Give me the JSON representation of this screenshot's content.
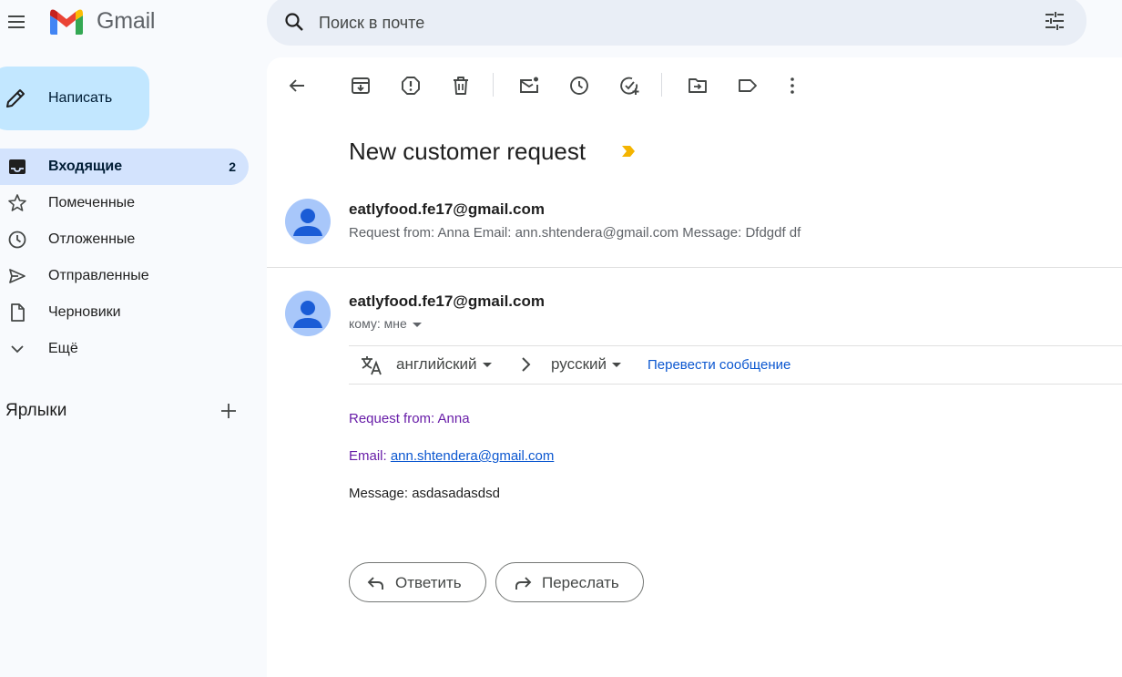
{
  "app": {
    "name": "Gmail",
    "brand_colors": [
      "#ea4335",
      "#4285f4",
      "#34a853",
      "#fbbc04",
      "#c5221f"
    ]
  },
  "search": {
    "placeholder": "Поиск в почте",
    "value": ""
  },
  "compose": {
    "label": "Написать",
    "icon": "pencil-icon"
  },
  "sidebar": {
    "items": [
      {
        "label": "Входящие",
        "icon": "inbox-icon",
        "count": "2",
        "active": true
      },
      {
        "label": "Помеченные",
        "icon": "star-icon",
        "count": "",
        "active": false
      },
      {
        "label": "Отложенные",
        "icon": "clock-icon",
        "count": "",
        "active": false
      },
      {
        "label": "Отправленные",
        "icon": "send-icon",
        "count": "",
        "active": false
      },
      {
        "label": "Черновики",
        "icon": "draft-icon",
        "count": "",
        "active": false
      },
      {
        "label": "Ещё",
        "icon": "chevron-down-icon",
        "count": "",
        "active": false
      }
    ],
    "labels_title": "Ярлыки"
  },
  "toolbar": {
    "actions": [
      "back",
      "archive",
      "report-spam",
      "delete",
      "mark-unread",
      "snooze",
      "add-to-tasks",
      "move-to",
      "labels",
      "more"
    ]
  },
  "email": {
    "subject": "New customer request",
    "importance_color": "#f4b400",
    "collapsed": {
      "sender": "eatlyfood.fe17@gmail.com",
      "snippet": "Request from: Anna Email: ann.shtendera@gmail.com Message: Dfdgdf df"
    },
    "expanded": {
      "sender": "eatlyfood.fe17@gmail.com",
      "to": "кому: мне",
      "body_line1": "Request from: Anna",
      "email_prefix": "Email: ",
      "email_link": "ann.shtendera@gmail.com",
      "body_line3": "Message: asdasadasdsd"
    }
  },
  "translate": {
    "source_lang": "английский",
    "target_lang": "русский",
    "action": "Перевести сообщение"
  },
  "actions": {
    "reply": "Ответить",
    "forward": "Переслать"
  }
}
